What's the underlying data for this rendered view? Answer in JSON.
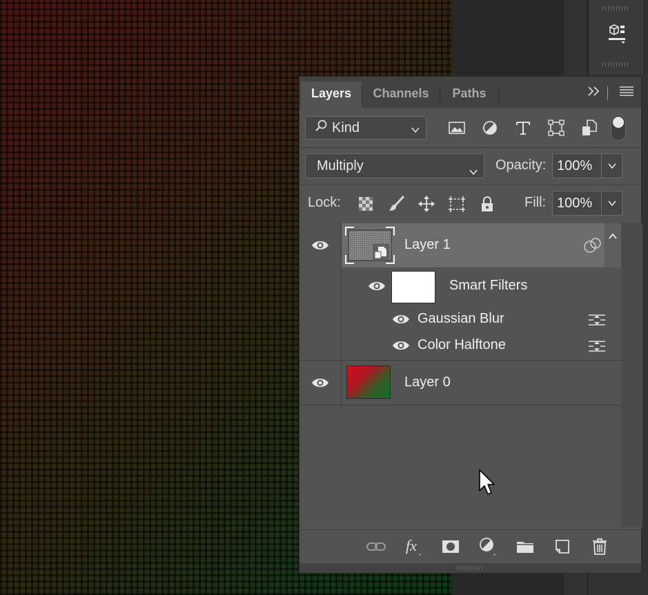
{
  "panel": {
    "tabs": [
      {
        "label": "Layers",
        "active": true
      },
      {
        "label": "Channels",
        "active": false
      },
      {
        "label": "Paths",
        "active": false
      }
    ],
    "tab_icons": [
      "expand-panels-icon",
      "panel-menu-icon"
    ]
  },
  "filter": {
    "kind_label": "Kind",
    "filter_icons": [
      "pixel-layer-filter-icon",
      "adjustment-layer-filter-icon",
      "type-layer-filter-icon",
      "shape-layer-filter-icon",
      "smart-object-filter-icon"
    ],
    "filter_toggle_on": true
  },
  "blend": {
    "mode": "Multiply",
    "opacity_label": "Opacity:",
    "opacity_value": "100%"
  },
  "lock": {
    "label": "Lock:",
    "icons": [
      "lock-transparent-pixels-icon",
      "lock-image-pixels-icon",
      "lock-position-icon",
      "lock-artboard-icon",
      "lock-all-icon"
    ],
    "fill_label": "Fill:",
    "fill_value": "100%"
  },
  "layers": [
    {
      "name": "Layer 1",
      "type": "smart-object",
      "visible": true,
      "selected": true,
      "smart_filters": {
        "label": "Smart Filters",
        "visible": true,
        "filters": [
          {
            "name": "Gaussian Blur",
            "visible": true
          },
          {
            "name": "Color Halftone",
            "visible": true
          }
        ]
      }
    },
    {
      "name": "Layer 0",
      "type": "pixel",
      "visible": true,
      "selected": false,
      "thumb_colors": [
        "#d0101f",
        "#0f6e2a"
      ]
    }
  ],
  "footer_icons": [
    "link-layers-icon",
    "layer-style-fx-icon",
    "add-mask-icon",
    "new-adjustment-layer-icon",
    "new-group-icon",
    "new-layer-icon",
    "delete-layer-icon"
  ],
  "colors": {
    "panel_bg": "#535353",
    "selected_row": "#6c6c6c",
    "canvas_red": "#4a1612",
    "canvas_green": "#0f3a14"
  }
}
